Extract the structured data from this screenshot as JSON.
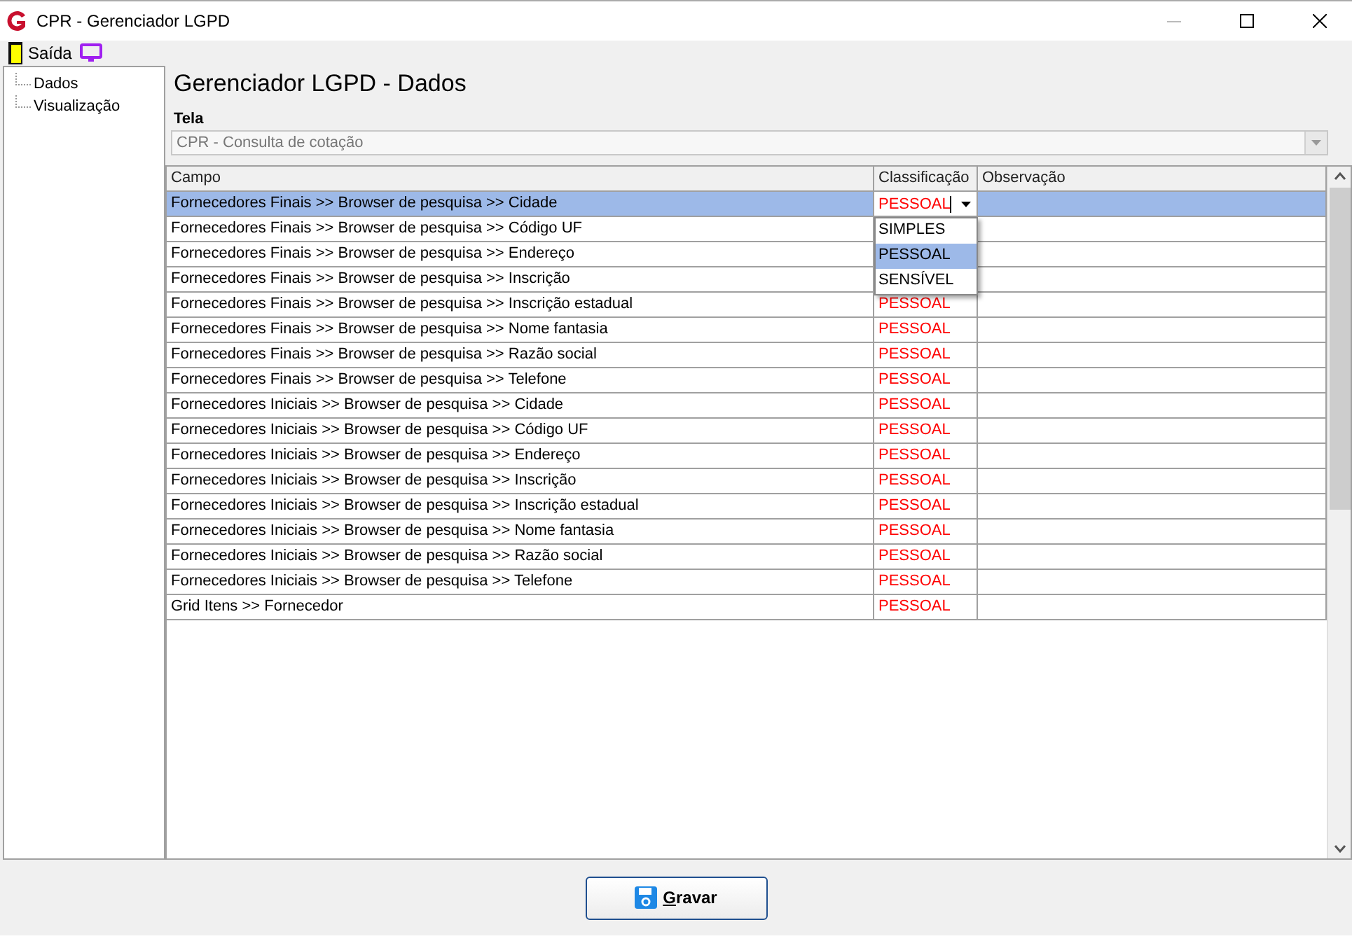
{
  "window": {
    "title": "CPR - Gerenciador LGPD"
  },
  "toolbar": {
    "exit_label": "Saída"
  },
  "sidebar": {
    "items": [
      {
        "label": "Dados",
        "selected": false
      },
      {
        "label": "Visualização",
        "selected": false
      }
    ]
  },
  "heading": "Gerenciador LGPD - Dados",
  "screen_field": {
    "label": "Tela",
    "value": "CPR - Consulta de cotação",
    "disabled": true
  },
  "table": {
    "columns": [
      "Campo",
      "Classificação",
      "Observação"
    ],
    "rows": [
      {
        "field": "Fornecedores Finais >> Browser de pesquisa >> Cidade",
        "classification": "PESSOAL",
        "selected": true,
        "editing": true
      },
      {
        "field": "Fornecedores Finais >> Browser de pesquisa >> Código UF",
        "selected": false
      },
      {
        "field": "Fornecedores Finais >> Browser de pesquisa >> Endereço",
        "selected": false
      },
      {
        "field": "Fornecedores Finais >> Browser de pesquisa >> Inscrição",
        "selected": false
      },
      {
        "field": "Fornecedores Finais >> Browser de pesquisa >> Inscrição estadual",
        "classification": "PESSOAL",
        "selected": false
      },
      {
        "field": "Fornecedores Finais >> Browser de pesquisa >> Nome fantasia",
        "classification": "PESSOAL",
        "selected": false
      },
      {
        "field": "Fornecedores Finais >> Browser de pesquisa >> Razão social",
        "classification": "PESSOAL",
        "selected": false
      },
      {
        "field": "Fornecedores Finais >> Browser de pesquisa >> Telefone",
        "classification": "PESSOAL",
        "selected": false
      },
      {
        "field": "Fornecedores Iniciais >> Browser de pesquisa >> Cidade",
        "classification": "PESSOAL",
        "selected": false
      },
      {
        "field": "Fornecedores Iniciais >> Browser de pesquisa >> Código UF",
        "classification": "PESSOAL",
        "selected": false
      },
      {
        "field": "Fornecedores Iniciais >> Browser de pesquisa >> Endereço",
        "classification": "PESSOAL",
        "selected": false
      },
      {
        "field": "Fornecedores Iniciais >> Browser de pesquisa >> Inscrição",
        "classification": "PESSOAL",
        "selected": false
      },
      {
        "field": "Fornecedores Iniciais >> Browser de pesquisa >> Inscrição estadual",
        "classification": "PESSOAL",
        "selected": false
      },
      {
        "field": "Fornecedores Iniciais >> Browser de pesquisa >> Nome fantasia",
        "classification": "PESSOAL",
        "selected": false
      },
      {
        "field": "Fornecedores Iniciais >> Browser de pesquisa >> Razão social",
        "classification": "PESSOAL",
        "selected": false
      },
      {
        "field": "Fornecedores Iniciais >> Browser de pesquisa >> Telefone",
        "classification": "PESSOAL",
        "selected": false
      },
      {
        "field": "Grid Itens >> Fornecedor",
        "classification": "PESSOAL",
        "selected": false
      }
    ]
  },
  "dropdown": {
    "options": [
      {
        "label": "SIMPLES",
        "selected": false
      },
      {
        "label": "PESSOAL",
        "selected": true
      },
      {
        "label": "SENSÍVEL",
        "selected": false
      }
    ]
  },
  "save_button": {
    "label": "Gravar"
  }
}
